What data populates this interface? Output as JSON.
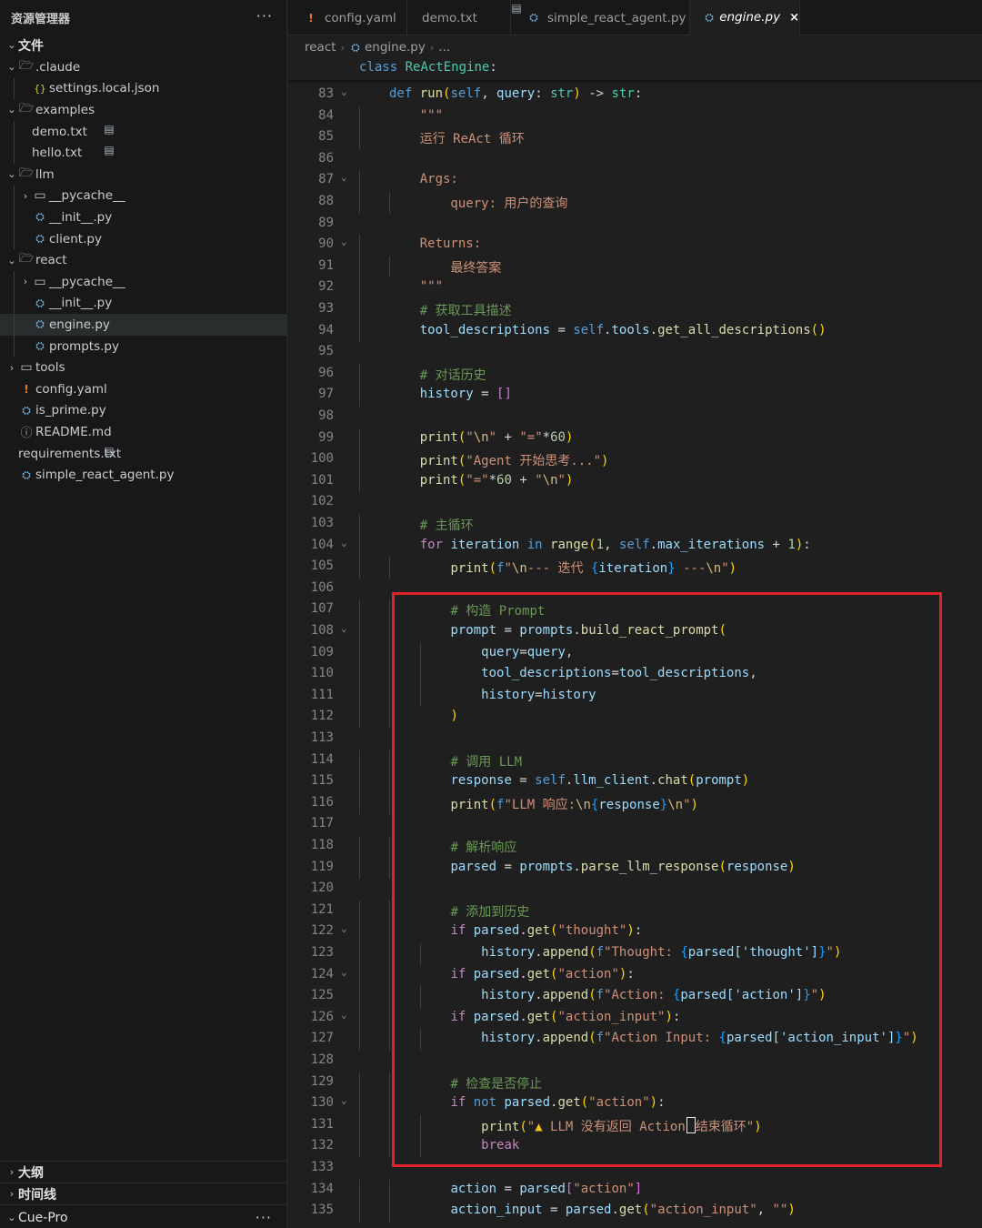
{
  "sidebar": {
    "title": "资源管理器",
    "more": "···",
    "section": "文件",
    "items": [
      {
        "label": ".claude",
        "type": "folder",
        "open": true,
        "depth": 0
      },
      {
        "label": "settings.local.json",
        "type": "json",
        "depth": 1
      },
      {
        "label": "examples",
        "type": "folder",
        "open": true,
        "depth": 0
      },
      {
        "label": "demo.txt",
        "type": "txt",
        "depth": 1
      },
      {
        "label": "hello.txt",
        "type": "txt",
        "depth": 1
      },
      {
        "label": "llm",
        "type": "folder",
        "open": true,
        "depth": 0
      },
      {
        "label": "__pycache__",
        "type": "folder",
        "open": false,
        "depth": 1
      },
      {
        "label": "__init__.py",
        "type": "py",
        "depth": 1
      },
      {
        "label": "client.py",
        "type": "py",
        "depth": 1
      },
      {
        "label": "react",
        "type": "folder",
        "open": true,
        "depth": 0
      },
      {
        "label": "__pycache__",
        "type": "folder",
        "open": false,
        "depth": 1
      },
      {
        "label": "__init__.py",
        "type": "py",
        "depth": 1
      },
      {
        "label": "engine.py",
        "type": "py",
        "depth": 1,
        "selected": true
      },
      {
        "label": "prompts.py",
        "type": "py",
        "depth": 1
      },
      {
        "label": "tools",
        "type": "folder",
        "open": false,
        "depth": 0
      },
      {
        "label": "config.yaml",
        "type": "yaml",
        "depth": 0
      },
      {
        "label": "is_prime.py",
        "type": "py",
        "depth": 0
      },
      {
        "label": "README.md",
        "type": "info",
        "depth": 0
      },
      {
        "label": "requirements.txt",
        "type": "txt",
        "depth": 0
      },
      {
        "label": "simple_react_agent.py",
        "type": "py",
        "depth": 0
      }
    ],
    "bottom_sections": [
      "大纲",
      "时间线",
      "Cue-Pro"
    ]
  },
  "tabs": [
    {
      "label": "config.yaml",
      "type": "yaml",
      "active": false
    },
    {
      "label": "demo.txt",
      "type": "txt",
      "active": false
    },
    {
      "label": "simple_react_agent.py",
      "type": "py",
      "active": false
    },
    {
      "label": "engine.py",
      "type": "py",
      "active": true,
      "close": "×"
    }
  ],
  "breadcrumb": {
    "folder": "react",
    "file": "engine.py",
    "more": "..."
  },
  "sticky_header": "class ReActEngine:",
  "icons": {
    "folder": "folder-icon",
    "py": "python-file-icon",
    "txt": "text-file-icon",
    "json": "json-file-icon",
    "yaml": "yaml-file-icon",
    "info": "info-icon",
    "chevron_open": "chevron-down-icon",
    "chevron_closed": "chevron-right-icon"
  },
  "colors": {
    "highlight": "#e0222a",
    "background": "#1f1f1f",
    "sidebar": "#181818"
  },
  "code": {
    "fold_lines": [
      83,
      87,
      90,
      104,
      108,
      122,
      124,
      126,
      130
    ],
    "lines": [
      {
        "n": "83",
        "t": "def run(self, query: str) -> str:"
      },
      {
        "n": "84",
        "t": "    \"\"\""
      },
      {
        "n": "85",
        "t": "    运行 ReAct 循环"
      },
      {
        "n": "86",
        "t": ""
      },
      {
        "n": "87",
        "t": "    Args:"
      },
      {
        "n": "88",
        "t": "        query: 用户的查询"
      },
      {
        "n": "89",
        "t": ""
      },
      {
        "n": "90",
        "t": "    Returns:"
      },
      {
        "n": "91",
        "t": "        最终答案"
      },
      {
        "n": "92",
        "t": "    \"\"\""
      },
      {
        "n": "93",
        "t": "    # 获取工具描述"
      },
      {
        "n": "94",
        "t": "    tool_descriptions = self.tools.get_all_descriptions()"
      },
      {
        "n": "95",
        "t": ""
      },
      {
        "n": "96",
        "t": "    # 对话历史"
      },
      {
        "n": "97",
        "t": "    history = []"
      },
      {
        "n": "98",
        "t": ""
      },
      {
        "n": "99",
        "t": "    print(\"\\n\" + \"=\"*60)"
      },
      {
        "n": "100",
        "t": "    print(\"Agent 开始思考...\")"
      },
      {
        "n": "101",
        "t": "    print(\"=\"*60 + \"\\n\")"
      },
      {
        "n": "102",
        "t": ""
      },
      {
        "n": "103",
        "t": "    # 主循环"
      },
      {
        "n": "104",
        "t": "    for iteration in range(1, self.max_iterations + 1):"
      },
      {
        "n": "105",
        "t": "        print(f\"\\n--- 迭代 {iteration} ---\\n\")"
      },
      {
        "n": "106",
        "t": ""
      },
      {
        "n": "107",
        "t": "        # 构造 Prompt"
      },
      {
        "n": "108",
        "t": "        prompt = prompts.build_react_prompt("
      },
      {
        "n": "109",
        "t": "            query=query,"
      },
      {
        "n": "110",
        "t": "            tool_descriptions=tool_descriptions,"
      },
      {
        "n": "111",
        "t": "            history=history"
      },
      {
        "n": "112",
        "t": "        )"
      },
      {
        "n": "113",
        "t": ""
      },
      {
        "n": "114",
        "t": "        # 调用 LLM"
      },
      {
        "n": "115",
        "t": "        response = self.llm_client.chat(prompt)"
      },
      {
        "n": "116",
        "t": "        print(f\"LLM 响应:\\n{response}\\n\")"
      },
      {
        "n": "117",
        "t": ""
      },
      {
        "n": "118",
        "t": "        # 解析响应"
      },
      {
        "n": "119",
        "t": "        parsed = prompts.parse_llm_response(response)"
      },
      {
        "n": "120",
        "t": ""
      },
      {
        "n": "121",
        "t": "        # 添加到历史"
      },
      {
        "n": "122",
        "t": "        if parsed.get(\"thought\"):"
      },
      {
        "n": "123",
        "t": "            history.append(f\"Thought: {parsed['thought']}\")"
      },
      {
        "n": "124",
        "t": "        if parsed.get(\"action\"):"
      },
      {
        "n": "125",
        "t": "            history.append(f\"Action: {parsed['action']}\")"
      },
      {
        "n": "126",
        "t": "        if parsed.get(\"action_input\"):"
      },
      {
        "n": "127",
        "t": "            history.append(f\"Action Input: {parsed['action_input']}\")"
      },
      {
        "n": "128",
        "t": ""
      },
      {
        "n": "129",
        "t": "        # 检查是否停止"
      },
      {
        "n": "130",
        "t": "        if not parsed.get(\"action\"):"
      },
      {
        "n": "131",
        "t": "            print(\"⚠️ LLM 没有返回 Action，结束循环\")"
      },
      {
        "n": "132",
        "t": "            break"
      },
      {
        "n": "133",
        "t": ""
      },
      {
        "n": "134",
        "t": "        action = parsed[\"action\"]"
      },
      {
        "n": "135",
        "t": "        action_input = parsed.get(\"action_input\", \"\")"
      }
    ]
  }
}
